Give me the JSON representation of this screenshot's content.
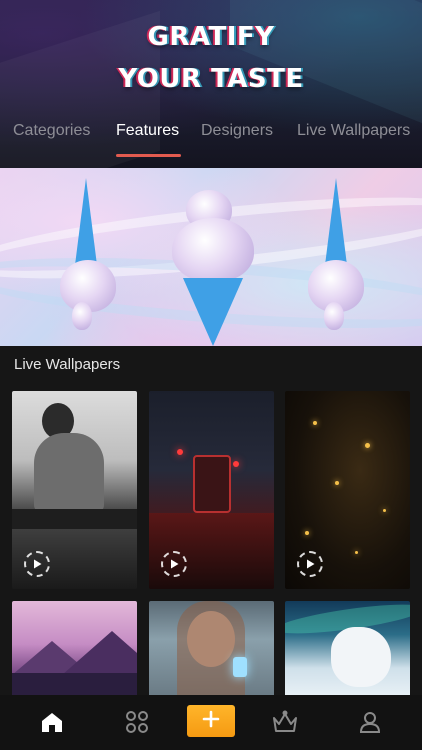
{
  "header": {
    "headline_line1": "GRATIFY",
    "headline_line2": "YOUR TASTE"
  },
  "tabs": [
    {
      "label": "Categories",
      "active": false
    },
    {
      "label": "Features",
      "active": true
    },
    {
      "label": "Designers",
      "active": false
    },
    {
      "label": "Live Wallpapers",
      "active": false
    }
  ],
  "banner": {
    "subject": "ice-cream-cones-holographic"
  },
  "section": {
    "title": "Live Wallpapers"
  },
  "wallpapers": [
    {
      "subject": "woman-sitting-glitch",
      "live": true
    },
    {
      "subject": "city-tram-night-rain",
      "live": true
    },
    {
      "subject": "golden-bokeh-particles",
      "live": true
    },
    {
      "subject": "pink-mountain-lake",
      "live": false
    },
    {
      "subject": "woman-holding-lantern",
      "live": false
    },
    {
      "subject": "white-wolf-aurora",
      "live": false
    }
  ],
  "bottom_nav": [
    {
      "icon": "home-icon",
      "active": true
    },
    {
      "icon": "grid-icon",
      "active": false
    },
    {
      "icon": "plus-icon",
      "active": false
    },
    {
      "icon": "crown-icon",
      "active": false
    },
    {
      "icon": "profile-icon",
      "active": false
    }
  ],
  "colors": {
    "accent_underline": "#e35b4f",
    "add_button": "#f5a31a",
    "background": "#161616"
  }
}
